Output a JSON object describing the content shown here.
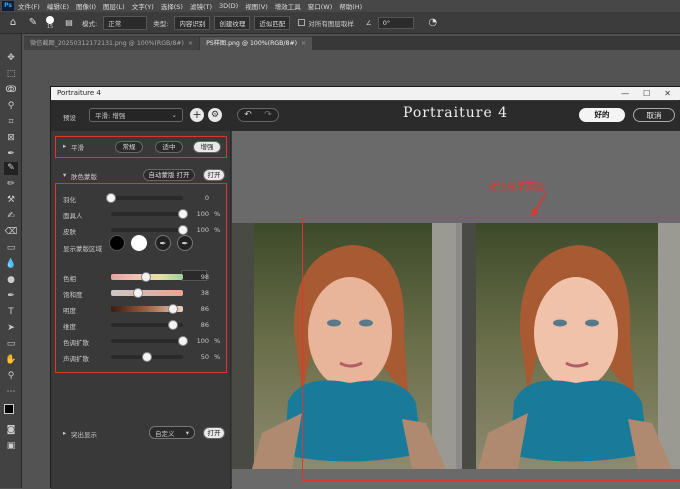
{
  "menubar": {
    "items": [
      "文件(F)",
      "编辑(E)",
      "图像(I)",
      "图层(L)",
      "文字(Y)",
      "选择(S)",
      "滤镜(T)",
      "3D(D)",
      "视图(V)",
      "增效工具",
      "窗口(W)",
      "帮助(H)"
    ]
  },
  "options": {
    "brush_size": "15",
    "mode_label": "模式:",
    "mode_value": "正常",
    "type_label": "类型:",
    "type_opt1": "内容识别",
    "type_opt2": "创建纹理",
    "type_opt3": "近似匹配",
    "sample_all": "对所有图层取样",
    "angle": "0°"
  },
  "tabs": [
    {
      "label": "微信截图_20250312172131.png @ 100%(RGB/8#)",
      "close": "×"
    },
    {
      "label": "PS样图.png @ 100%(RGB/8#)",
      "close": "×"
    }
  ],
  "window": {
    "title": "Portraiture 4",
    "minimize": "—",
    "maximize": "☐",
    "close": "✕"
  },
  "header": {
    "preset_label": "预设",
    "preset_value": "平滑: 增强",
    "brand": "Portraiture 4",
    "ok": "好的",
    "cancel": "取消"
  },
  "smoothing": {
    "label": "平滑",
    "options": [
      "常规",
      "适中",
      "增强"
    ],
    "selected": "增强"
  },
  "skin_mask": {
    "label": "肤色蒙版",
    "auto_mask": "自动蒙版 打开",
    "open": "打开"
  },
  "sliders": [
    {
      "label": "羽化",
      "value": "0",
      "unit": "",
      "level": 0.0
    },
    {
      "label": "面具人",
      "value": "100",
      "unit": "%",
      "level": 1.0
    },
    {
      "label": "皮肤",
      "value": "100",
      "unit": "%",
      "level": 1.0
    }
  ],
  "show_mask": {
    "label": "显示蒙版区域"
  },
  "color_sliders": [
    {
      "label": "色相",
      "value": "98",
      "unit": "",
      "level": 0.49,
      "gradient": "linear-gradient(90deg,#e8a0a0,#f0c0b0,#e8e0a0,#a0d0a0)"
    },
    {
      "label": "饱和度",
      "value": "38",
      "unit": "",
      "level": 0.38,
      "gradient": "linear-gradient(90deg,#c8c8c8,#f0a090)"
    },
    {
      "label": "明度",
      "value": "86",
      "unit": "",
      "level": 0.86,
      "gradient": "linear-gradient(90deg,#3a1a10,#a06040,#f0d0c0)"
    },
    {
      "label": "维度",
      "value": "86",
      "unit": "",
      "level": 0.86,
      "gradient": ""
    },
    {
      "label": "色调扩散",
      "value": "100",
      "unit": "%",
      "level": 1.0,
      "gradient": ""
    },
    {
      "label": "声调扩散",
      "value": "50",
      "unit": "%",
      "level": 0.5,
      "gradient": ""
    }
  ],
  "highlight": {
    "label": "突出显示",
    "dropdown": "自定义",
    "open": "打开"
  },
  "annotation": "对比效果预览",
  "colors": {
    "accent_red": "#e0342f",
    "panel": "#393939"
  }
}
